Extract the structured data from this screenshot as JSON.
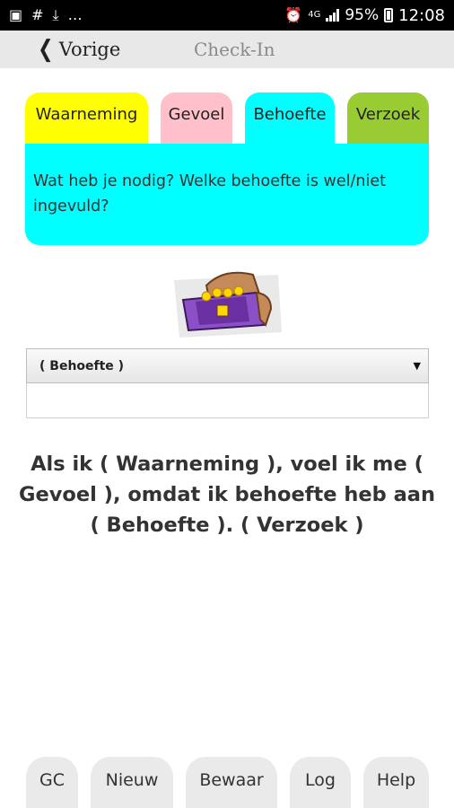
{
  "status_bar": {
    "battery": "95%",
    "time": "12:08",
    "network": "4G",
    "left_icons": [
      "image-icon",
      "slack-icon",
      "download-icon",
      "more-icon"
    ],
    "right_icons": [
      "alarm-icon",
      "signal-icon",
      "battery-icon"
    ]
  },
  "nav": {
    "back_label": "Vorige",
    "title": "Check-In"
  },
  "tabs": [
    {
      "label": "Waarneming",
      "color": "#ffff00"
    },
    {
      "label": "Gevoel",
      "color": "#ffc0cb"
    },
    {
      "label": "Behoefte",
      "color": "#00ffff",
      "active": true
    },
    {
      "label": "Verzoek",
      "color": "#99cc33"
    }
  ],
  "prompt": "Wat heb je nodig? Welke behoefte is wel/niet ingevuld?",
  "illustration": "treasure-chest-icon",
  "select": {
    "value": "( Behoefte )"
  },
  "text_field": {
    "value": ""
  },
  "sentence": "Als ik ( Waarneming ), voel ik me ( Gevoel ), omdat ik behoefte heb aan ( Behoefte ). ( Verzoek )",
  "bottom_buttons": [
    "GC",
    "Nieuw",
    "Bewaar",
    "Log",
    "Help"
  ]
}
